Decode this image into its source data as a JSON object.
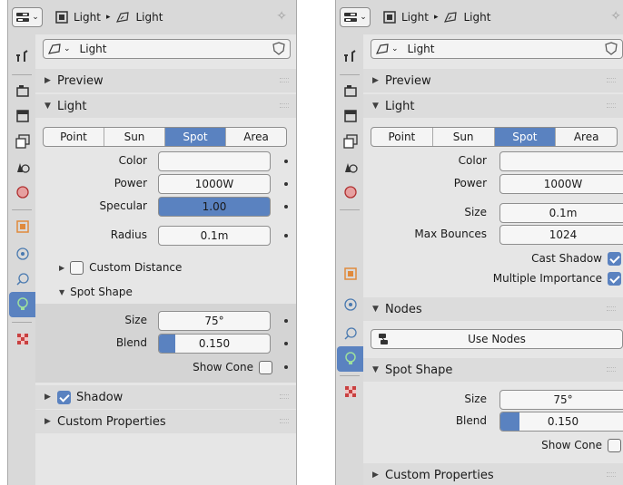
{
  "left": {
    "header": {
      "crumb_a": "Light",
      "crumb_b": "Light"
    },
    "datablock": {
      "name": "Light"
    },
    "sections": {
      "preview": "Preview",
      "light": "Light",
      "spot_shape": "Spot Shape",
      "shadow": "Shadow",
      "custom_props": "Custom Properties"
    },
    "light_types": [
      "Point",
      "Sun",
      "Spot",
      "Area"
    ],
    "light_type_selected": "Spot",
    "props": {
      "color_label": "Color",
      "power_label": "Power",
      "power_value": "1000W",
      "specular_label": "Specular",
      "specular_value": "1.00",
      "radius_label": "Radius",
      "radius_value": "0.1m",
      "custom_distance": "Custom Distance",
      "size_label": "Size",
      "size_value": "75°",
      "blend_label": "Blend",
      "blend_value": "0.150",
      "blend_fraction": 0.15,
      "show_cone": "Show Cone"
    },
    "shadow_checked": true
  },
  "right": {
    "header": {
      "crumb_a": "Light",
      "crumb_b": "Light"
    },
    "datablock": {
      "name": "Light"
    },
    "sections": {
      "preview": "Preview",
      "light": "Light",
      "nodes": "Nodes",
      "spot_shape": "Spot Shape",
      "custom_props": "Custom Properties"
    },
    "light_types": [
      "Point",
      "Sun",
      "Spot",
      "Area"
    ],
    "light_type_selected": "Spot",
    "props": {
      "color_label": "Color",
      "power_label": "Power",
      "power_value": "1000W",
      "size_label": "Size",
      "size_value": "0.1m",
      "max_bounces_label": "Max Bounces",
      "max_bounces_value": "1024",
      "cast_shadow": "Cast Shadow",
      "multiple_importance": "Multiple Importance",
      "use_nodes": "Use Nodes",
      "spot_size_label": "Size",
      "spot_size_value": "75°",
      "blend_label": "Blend",
      "blend_value": "0.150",
      "blend_fraction": 0.15,
      "show_cone": "Show Cone"
    }
  },
  "colors": {
    "accent": "#5a82c0",
    "panel": "#e6e6e6"
  }
}
